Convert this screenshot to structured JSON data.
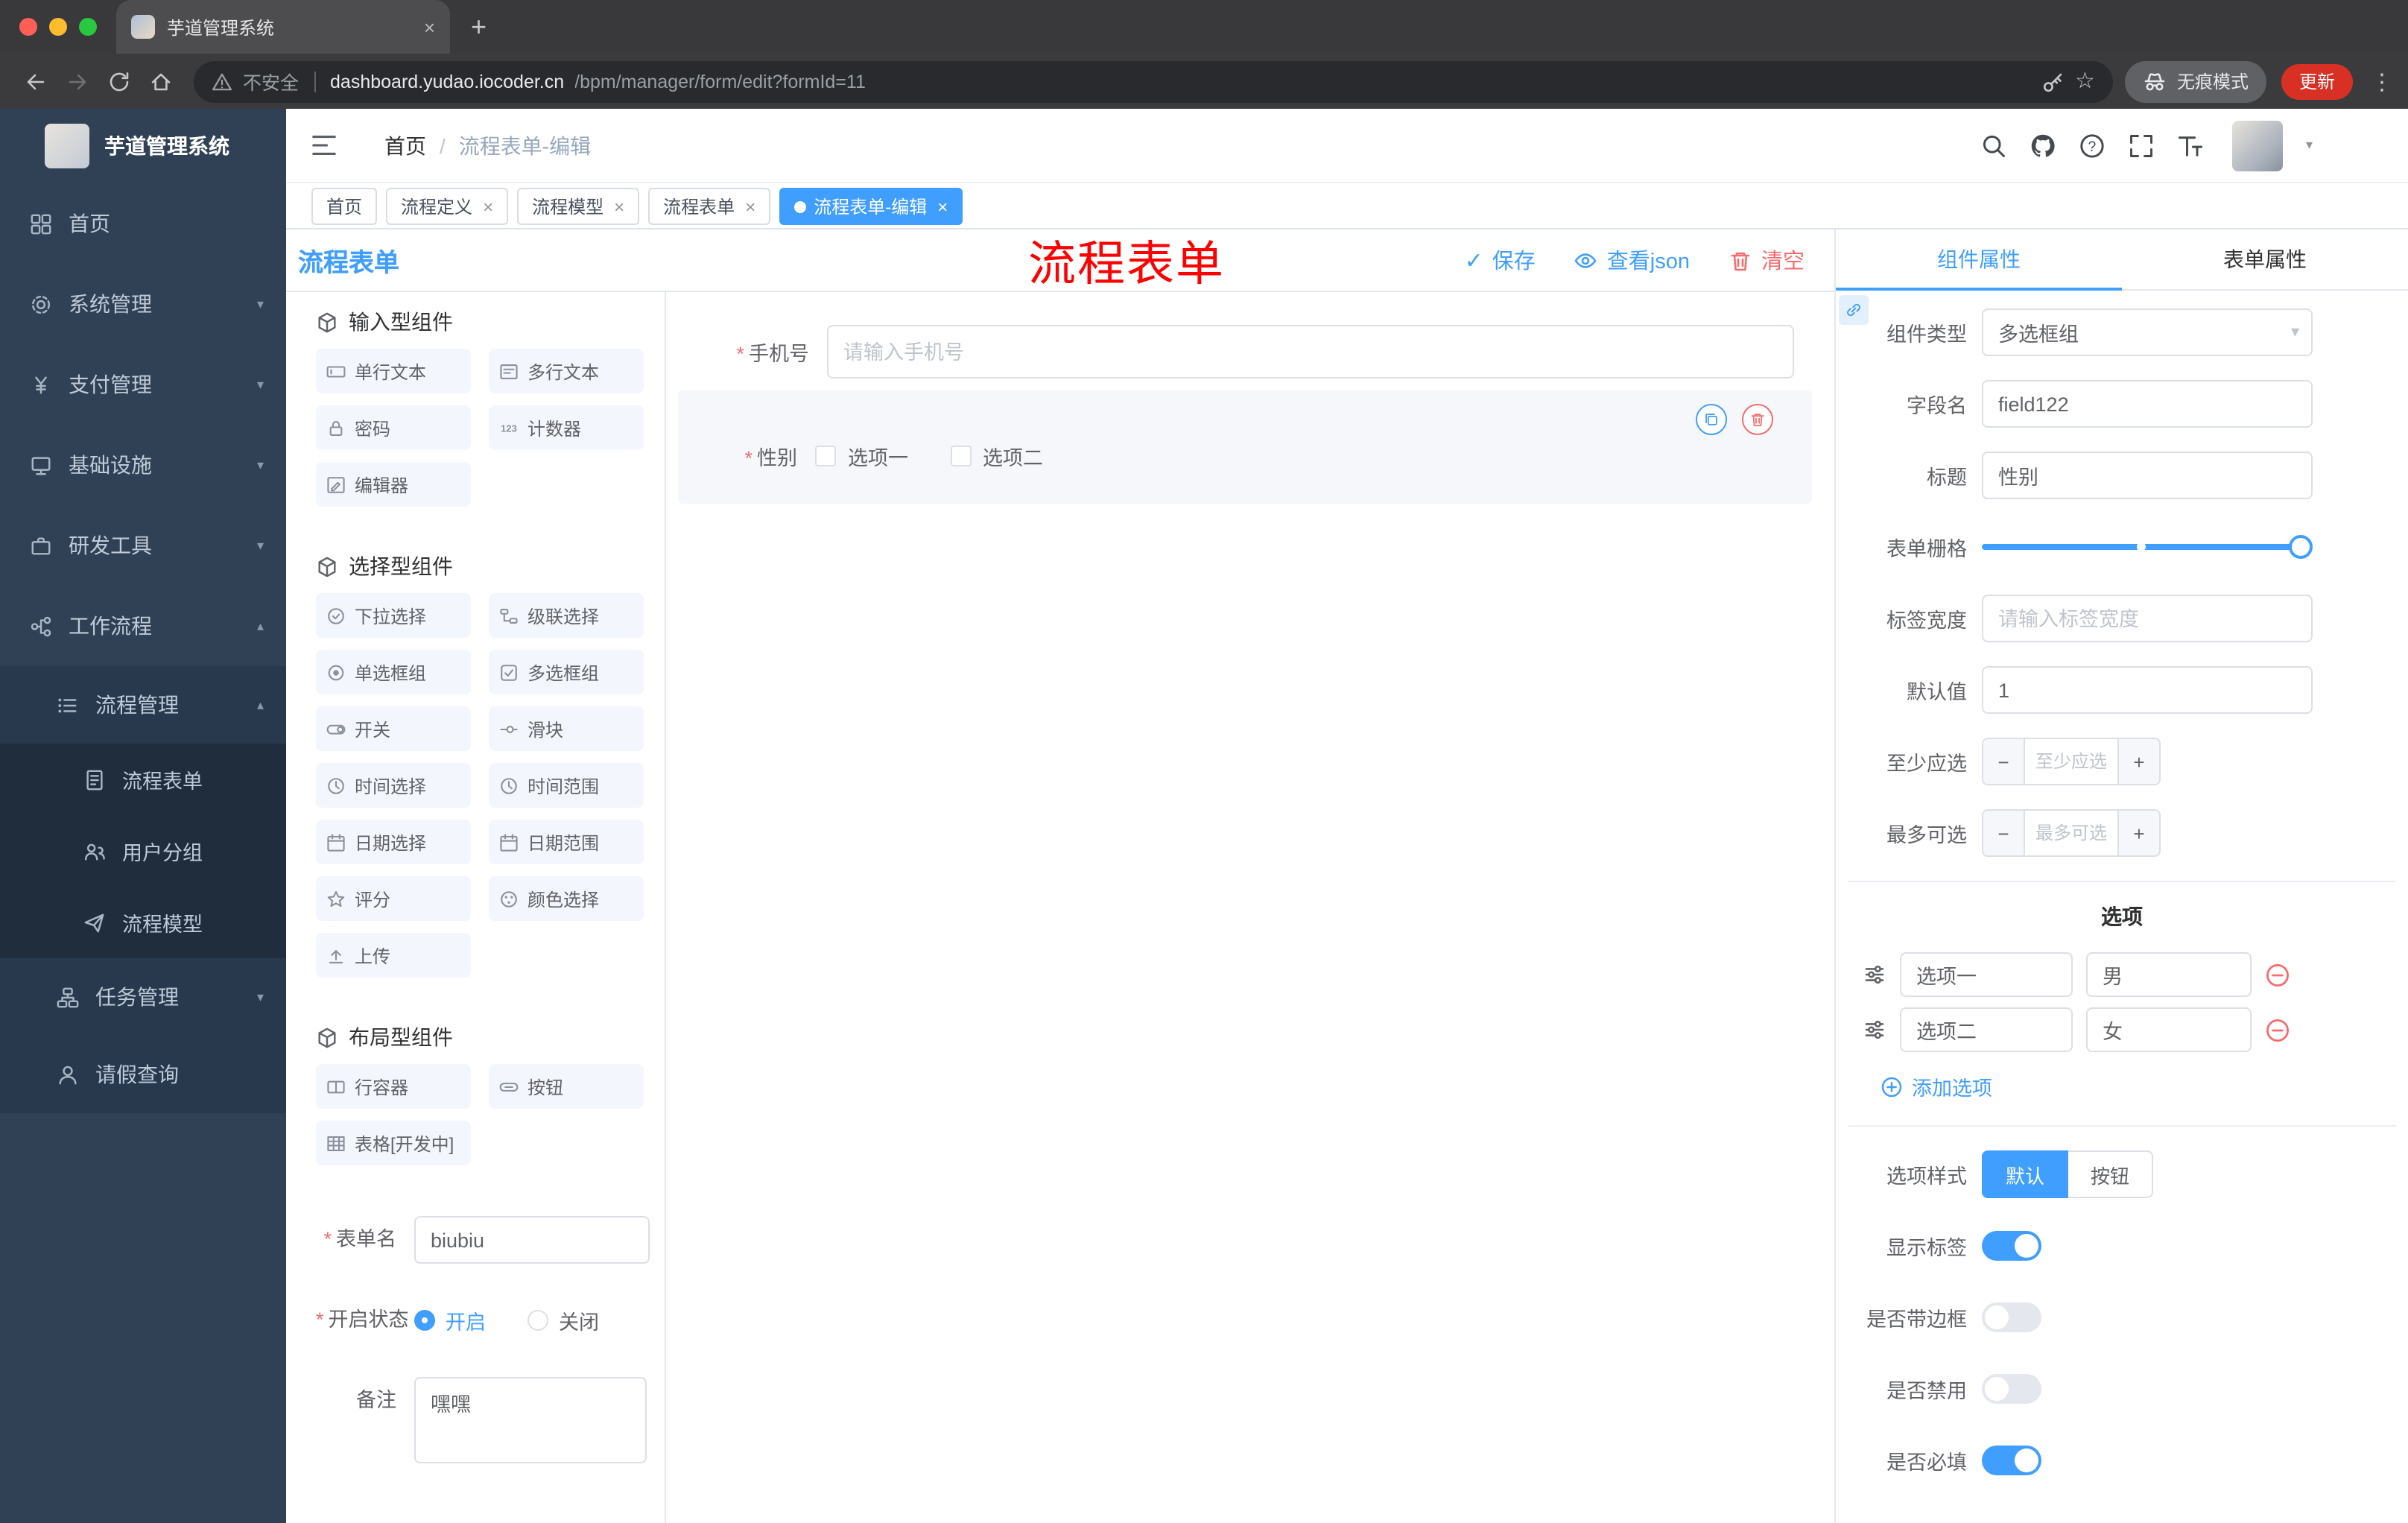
{
  "colors": {
    "accent": "#409EFF",
    "danger": "#F56C6C",
    "sidebar_bg": "#304156",
    "annotation": "#FF0000",
    "tab_active": "#409EFF"
  },
  "browser": {
    "tab_title": "芋道管理系统",
    "security": "不安全",
    "url_domain": "dashboard.yudao.iocoder.cn",
    "url_path": "/bpm/manager/form/edit?formId=11",
    "incognito": "无痕模式",
    "update": "更新"
  },
  "sidebar": {
    "title": "芋道管理系统",
    "items": [
      {
        "label": "首页"
      },
      {
        "label": "系统管理"
      },
      {
        "label": "支付管理"
      },
      {
        "label": "基础设施"
      },
      {
        "label": "研发工具"
      },
      {
        "label": "工作流程"
      },
      {
        "label": "流程管理"
      },
      {
        "label": "流程表单"
      },
      {
        "label": "用户分组"
      },
      {
        "label": "流程模型"
      },
      {
        "label": "任务管理"
      },
      {
        "label": "请假查询"
      }
    ]
  },
  "header": {
    "breadcrumb_home": "首页",
    "breadcrumb_sep": "/",
    "breadcrumb_current": "流程表单-编辑",
    "annotation": "流程表单"
  },
  "pagetabs": {
    "items": [
      {
        "label": "首页"
      },
      {
        "label": "流程定义"
      },
      {
        "label": "流程模型"
      },
      {
        "label": "流程表单"
      },
      {
        "label": "流程表单-编辑"
      }
    ]
  },
  "designer": {
    "title": "流程表单",
    "save": "保存",
    "view_json": "查看json",
    "clear": "清空"
  },
  "palette": {
    "section_input": "输入型组件",
    "section_select": "选择型组件",
    "section_layout": "布局型组件",
    "input_items": [
      "单行文本",
      "多行文本",
      "密码",
      "计数器",
      "编辑器"
    ],
    "select_items": [
      "下拉选择",
      "级联选择",
      "单选框组",
      "多选框组",
      "开关",
      "滑块",
      "时间选择",
      "时间范围",
      "日期选择",
      "日期范围",
      "评分",
      "颜色选择",
      "上传"
    ],
    "layout_items": [
      "行容器",
      "按钮",
      "表格[开发中]"
    ]
  },
  "form_meta": {
    "name_label": "表单名",
    "name_value": "biubiu",
    "status_label": "开启状态",
    "status_on": "开启",
    "status_off": "关闭",
    "remark_label": "备注",
    "remark_value": "嘿嘿"
  },
  "canvas": {
    "phone_label": "手机号",
    "phone_placeholder": "请输入手机号",
    "gender_label": "性别",
    "gender_opt1": "选项一",
    "gender_opt2": "选项二"
  },
  "props": {
    "tab_component": "组件属性",
    "tab_form": "表单属性",
    "component_type_label": "组件类型",
    "component_type_value": "多选框组",
    "field_label": "字段名",
    "field_value": "field122",
    "title_label": "标题",
    "title_value": "性别",
    "grid_label": "表单栅格",
    "width_label": "标签宽度",
    "width_placeholder": "请输入标签宽度",
    "default_label": "默认值",
    "default_value": "1",
    "min_label": "至少应选",
    "min_placeholder": "至少应选",
    "max_label": "最多可选",
    "max_placeholder": "最多可选",
    "options_title": "选项",
    "options": [
      {
        "label": "选项一",
        "value": "男"
      },
      {
        "label": "选项二",
        "value": "女"
      }
    ],
    "add_option": "添加选项",
    "style_label": "选项样式",
    "style_default": "默认",
    "style_button": "按钮",
    "toggles": [
      {
        "label": "显示标签",
        "on": true
      },
      {
        "label": "是否带边框",
        "on": false
      },
      {
        "label": "是否禁用",
        "on": false
      },
      {
        "label": "是否必填",
        "on": true
      }
    ]
  }
}
